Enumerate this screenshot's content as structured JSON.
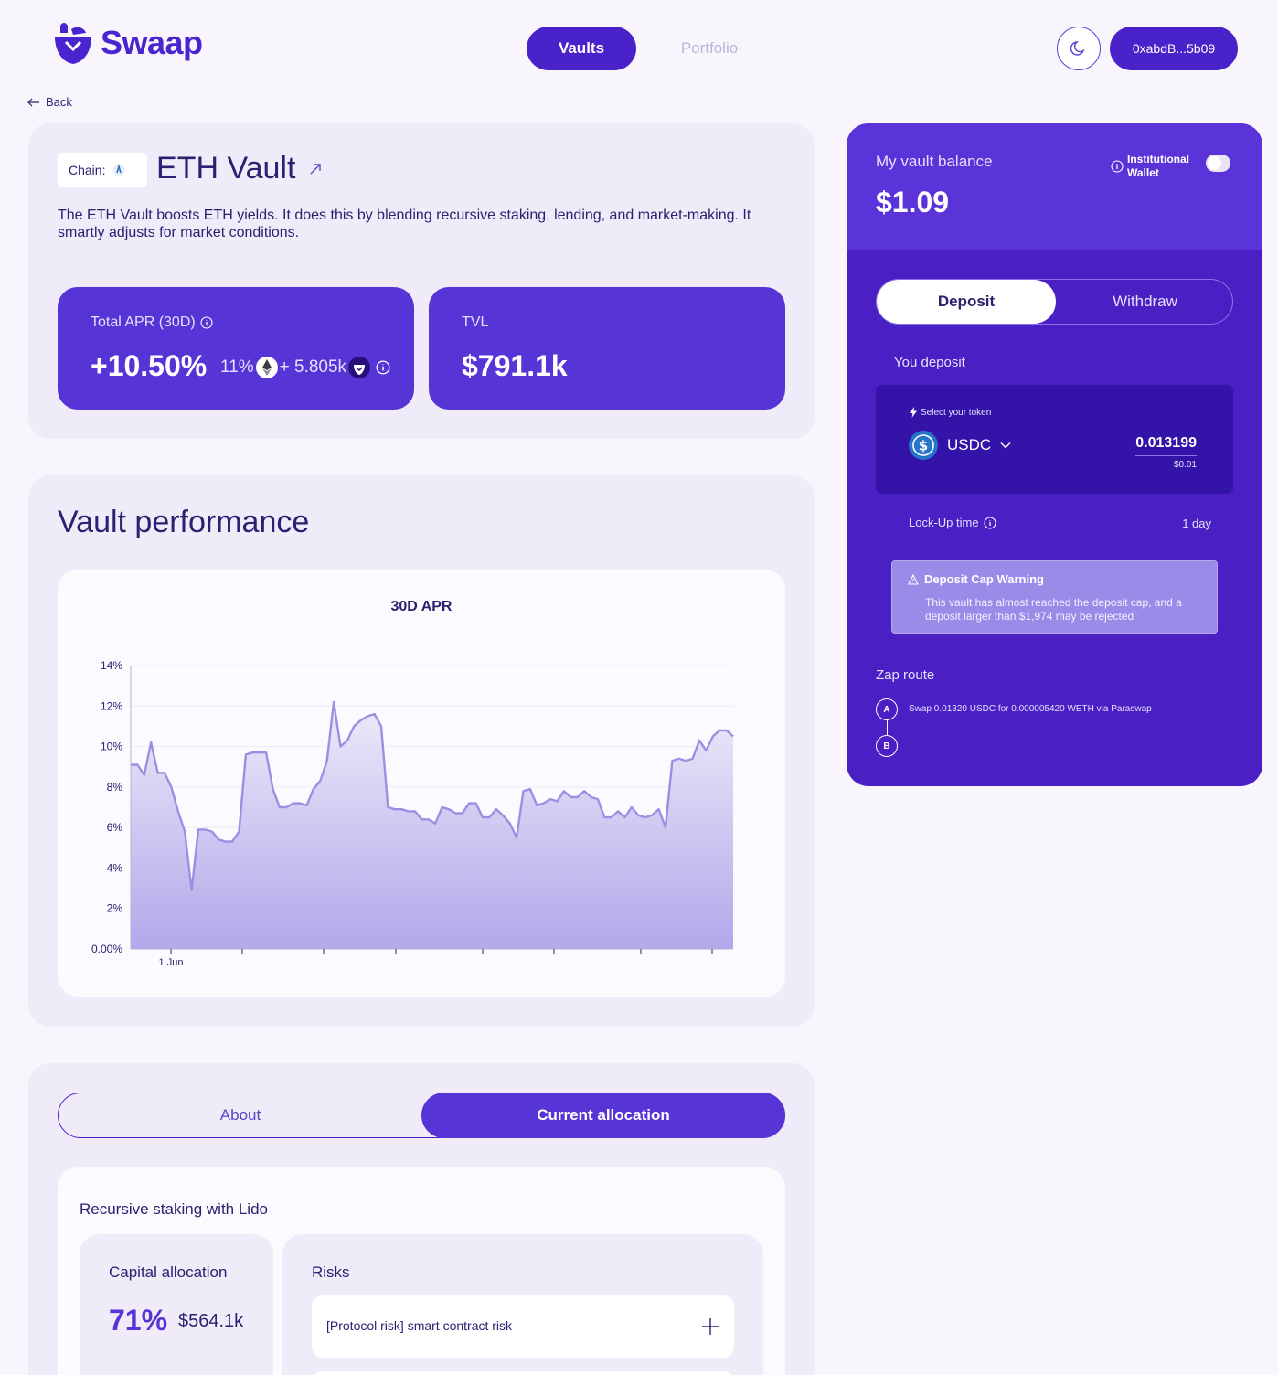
{
  "header": {
    "logo_text": "Swaap",
    "nav_vaults": "Vaults",
    "nav_portfolio": "Portfolio",
    "wallet_address": "0xabdB...5b09"
  },
  "back_label": "Back",
  "vault": {
    "chain_label": "Chain:",
    "title": "ETH Vault",
    "description": "The ETH Vault boosts ETH yields. It does this by blending recursive staking, lending, and market-making. It smartly adjusts for market conditions.",
    "apr_label": "Total APR (30D)",
    "apr_value": "+10.50%",
    "apr_eth": "11%",
    "apr_swaap": "+ 5.805k",
    "tvl_label": "TVL",
    "tvl_value": "$791.1k"
  },
  "performance": {
    "title": "Vault performance"
  },
  "chart_data": {
    "type": "area",
    "title": "30D APR",
    "xlabel": "",
    "ylabel": "",
    "y_ticks": [
      "0.00%",
      "2%",
      "4%",
      "6%",
      "8%",
      "10%",
      "12%",
      "14%"
    ],
    "x_tick_labels": [
      "1 Jun"
    ],
    "ylim": [
      0,
      14
    ],
    "grid": true,
    "color": "#9d8ee2",
    "values": [
      9.1,
      9.1,
      8.6,
      10.2,
      8.7,
      8.7,
      8.0,
      6.8,
      5.8,
      2.9,
      5.9,
      5.9,
      5.8,
      5.4,
      5.3,
      5.3,
      5.8,
      9.6,
      9.7,
      9.7,
      9.7,
      7.9,
      7.0,
      7.0,
      7.2,
      7.2,
      7.1,
      7.9,
      8.3,
      9.3,
      12.2,
      10.0,
      10.3,
      11.0,
      11.3,
      11.5,
      11.6,
      11.0,
      7.0,
      6.9,
      6.9,
      6.8,
      6.8,
      6.4,
      6.4,
      6.2,
      7.0,
      6.9,
      6.7,
      6.7,
      7.2,
      7.2,
      6.5,
      6.5,
      6.9,
      6.6,
      6.2,
      5.5,
      7.8,
      7.9,
      7.1,
      7.2,
      7.4,
      7.3,
      7.8,
      7.5,
      7.5,
      7.8,
      7.5,
      7.4,
      6.5,
      6.5,
      6.8,
      6.5,
      7.0,
      6.6,
      6.5,
      6.6,
      6.9,
      6.0,
      9.3,
      9.4,
      9.3,
      9.4,
      10.3,
      9.8,
      10.5,
      10.8,
      10.8,
      10.5
    ],
    "legend": "none"
  },
  "allocation": {
    "tab_about": "About",
    "tab_current": "Current allocation",
    "strategy_title": "Recursive staking with Lido",
    "capital_label": "Capital allocation",
    "capital_pct": "71%",
    "capital_amount": "$564.1k",
    "risks_label": "Risks",
    "risk_item": "[Protocol risk] smart contract risk"
  },
  "panel": {
    "balance_label": "My vault balance",
    "balance_value": "$1.09",
    "institutional_line1": "Institutional",
    "institutional_line2": "Wallet",
    "tab_deposit": "Deposit",
    "tab_withdraw": "Withdraw",
    "you_deposit": "You deposit",
    "select_token": "Select your token",
    "token": "USDC",
    "amount": "0.013199",
    "amount_usd": "$0.01",
    "lockup_label": "Lock-Up time",
    "lockup_value": "1 day",
    "warning_title": "Deposit Cap Warning",
    "warning_text": "This vault has almost reached the deposit cap, and a deposit larger than $1,974 may be rejected",
    "zap_label": "Zap route",
    "zap_a": "A",
    "zap_b": "B",
    "zap_step": "Swap 0.01320 USDC for 0.000005420 WETH via Paraswap"
  },
  "colors": {
    "primary": "#4a22c9",
    "accent": "#5634d6",
    "background": "#f8f6fc",
    "card": "#f0ebf8"
  }
}
